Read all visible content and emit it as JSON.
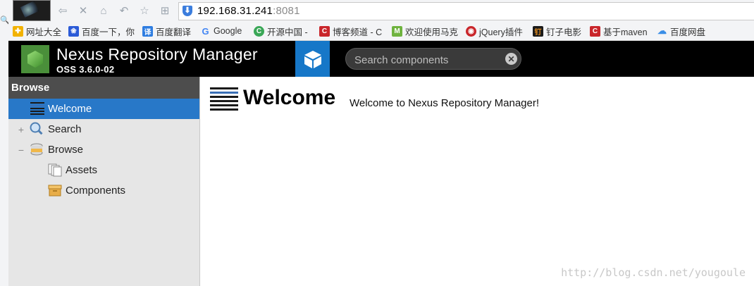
{
  "browser": {
    "url_host": "192.168.31.241",
    "url_port": ":8081",
    "bookmarks": [
      {
        "label": "网址大全",
        "icon": "globe-icon",
        "color": "#f2b200"
      },
      {
        "label": "百度一下，你",
        "icon": "baidu-paw-icon",
        "color": "#2b5bd7"
      },
      {
        "label": "百度翻译",
        "icon": "translate-icon",
        "color": "#2e7de1"
      },
      {
        "label": "Google",
        "icon": "google-icon",
        "color": "#4285f4"
      },
      {
        "label": "开源中国 -",
        "icon": "oschina-icon",
        "color": "#3aa757"
      },
      {
        "label": "博客频道 - C",
        "icon": "csdn-icon",
        "color": "#c9262b"
      },
      {
        "label": "欢迎使用马克",
        "icon": "marxico-icon",
        "color": "#6fb33f"
      },
      {
        "label": "jQuery插件",
        "icon": "jquery-icon",
        "color": "#c9262b"
      },
      {
        "label": "钉子电影",
        "icon": "dingzi-icon",
        "color": "#1b1b1b"
      },
      {
        "label": "基于maven",
        "icon": "csdn-icon",
        "color": "#c9262b"
      },
      {
        "label": "百度网盘",
        "icon": "cloud-icon",
        "color": "#3a8ee6"
      }
    ]
  },
  "header": {
    "title": "Nexus Repository Manager",
    "version": "OSS 3.6.0-02",
    "search_placeholder": "Search components",
    "accent": "#1677c8"
  },
  "sidebar": {
    "title": "Browse",
    "items": [
      {
        "label": "Welcome",
        "selected": true
      },
      {
        "label": "Search",
        "expander": "+"
      },
      {
        "label": "Browse",
        "expander": "−"
      },
      {
        "label": "Assets"
      },
      {
        "label": "Components"
      }
    ]
  },
  "main": {
    "title": "Welcome",
    "message": "Welcome to Nexus Repository Manager!"
  },
  "watermark": "http://blog.csdn.net/yougoule"
}
